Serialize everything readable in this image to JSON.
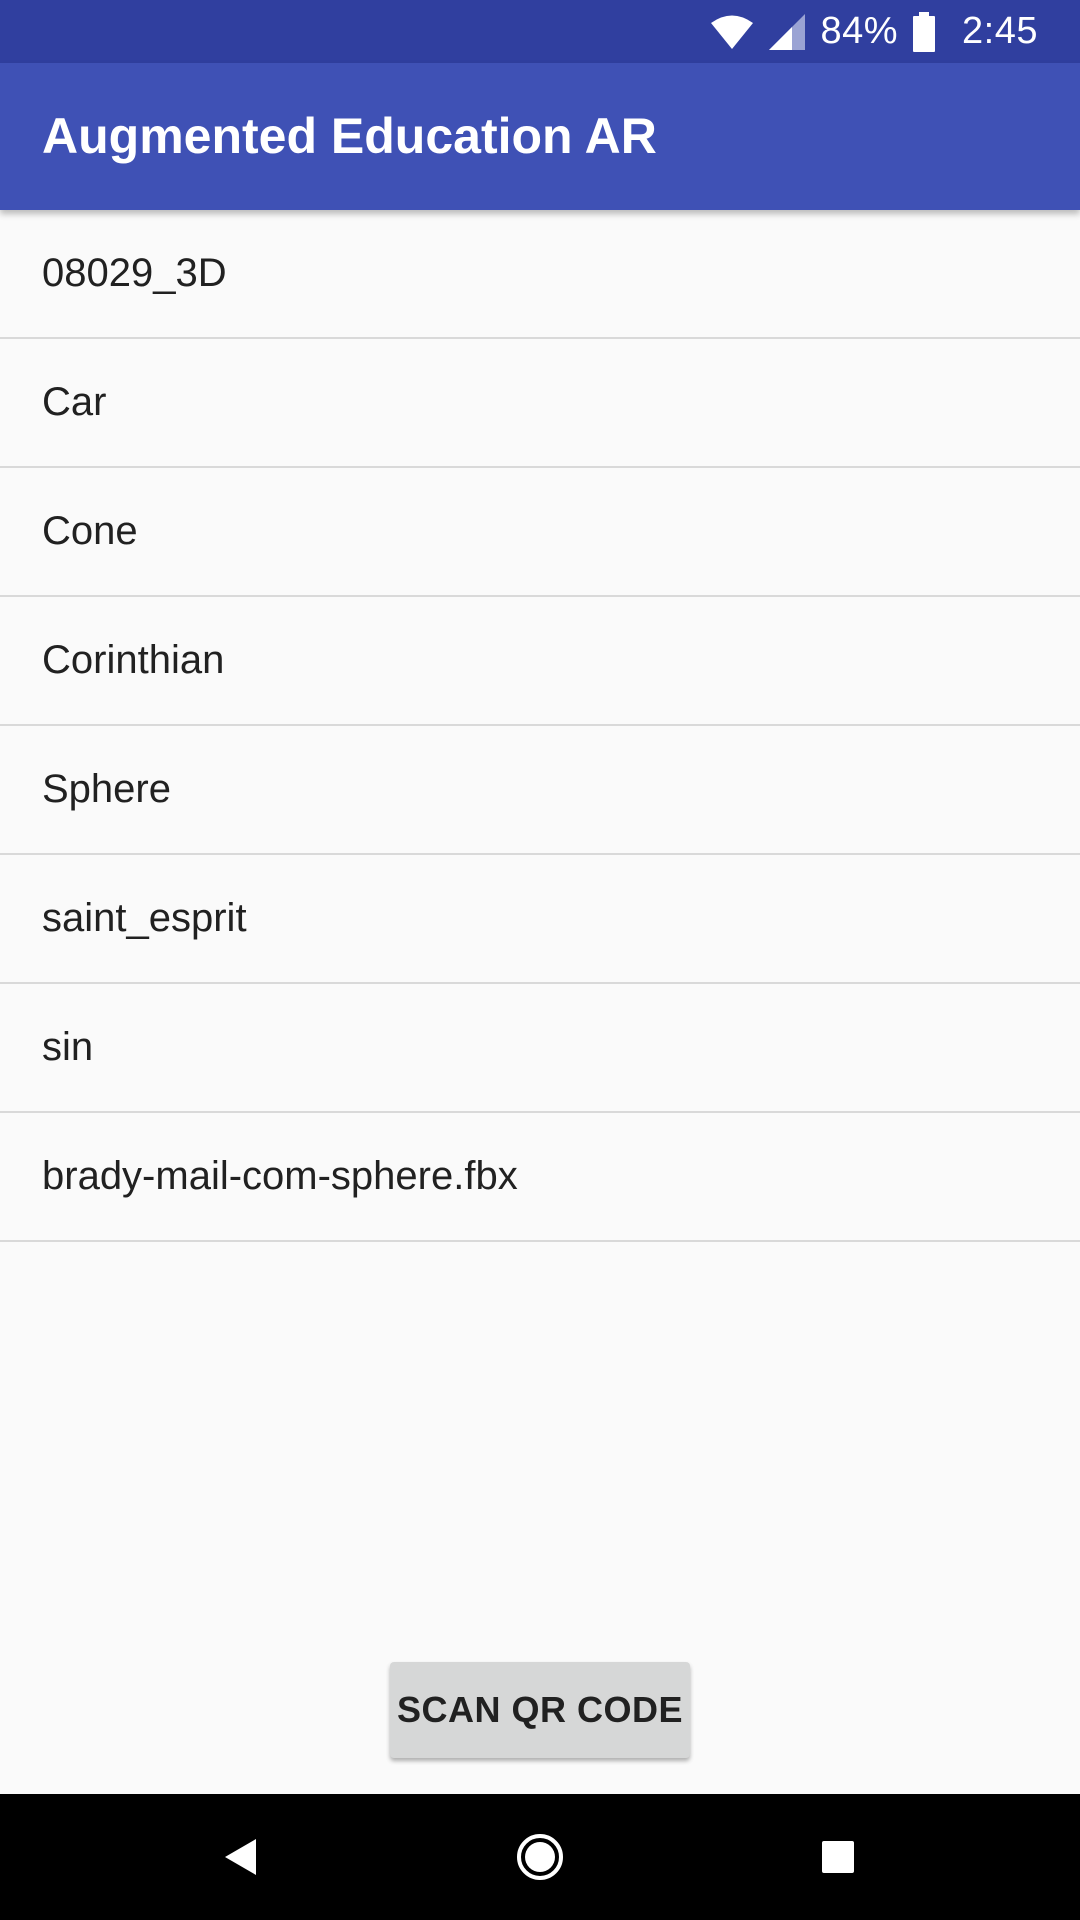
{
  "status_bar": {
    "battery_percent": "84%",
    "time": "2:45",
    "icons": [
      "wifi-icon",
      "cell-signal-icon",
      "battery-icon"
    ],
    "background_color": "#303f9f"
  },
  "app_bar": {
    "title": "Augmented Education AR",
    "background_color": "#3f51b5"
  },
  "models": [
    {
      "label": "08029_3D"
    },
    {
      "label": "Car"
    },
    {
      "label": "Cone"
    },
    {
      "label": "Corinthian"
    },
    {
      "label": "Sphere"
    },
    {
      "label": "saint_esprit"
    },
    {
      "label": "sin"
    },
    {
      "label": "brady-mail-com-sphere.fbx"
    }
  ],
  "scan_button": {
    "label": "SCAN QR CODE"
  },
  "nav_bar": {
    "icons": [
      "back-icon",
      "home-icon",
      "recents-icon"
    ]
  }
}
